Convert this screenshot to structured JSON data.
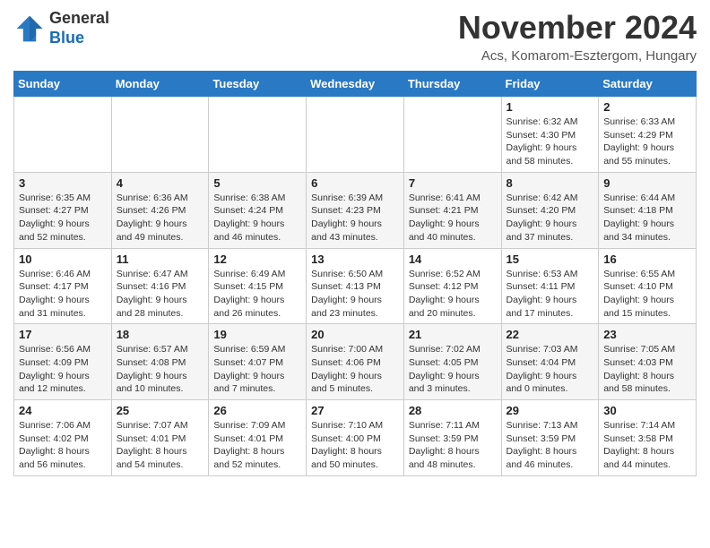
{
  "header": {
    "logo_line1": "General",
    "logo_line2": "Blue",
    "month": "November 2024",
    "location": "Acs, Komarom-Esztergom, Hungary"
  },
  "weekdays": [
    "Sunday",
    "Monday",
    "Tuesday",
    "Wednesday",
    "Thursday",
    "Friday",
    "Saturday"
  ],
  "weeks": [
    [
      {
        "day": "",
        "info": ""
      },
      {
        "day": "",
        "info": ""
      },
      {
        "day": "",
        "info": ""
      },
      {
        "day": "",
        "info": ""
      },
      {
        "day": "",
        "info": ""
      },
      {
        "day": "1",
        "info": "Sunrise: 6:32 AM\nSunset: 4:30 PM\nDaylight: 9 hours and 58 minutes."
      },
      {
        "day": "2",
        "info": "Sunrise: 6:33 AM\nSunset: 4:29 PM\nDaylight: 9 hours and 55 minutes."
      }
    ],
    [
      {
        "day": "3",
        "info": "Sunrise: 6:35 AM\nSunset: 4:27 PM\nDaylight: 9 hours and 52 minutes."
      },
      {
        "day": "4",
        "info": "Sunrise: 6:36 AM\nSunset: 4:26 PM\nDaylight: 9 hours and 49 minutes."
      },
      {
        "day": "5",
        "info": "Sunrise: 6:38 AM\nSunset: 4:24 PM\nDaylight: 9 hours and 46 minutes."
      },
      {
        "day": "6",
        "info": "Sunrise: 6:39 AM\nSunset: 4:23 PM\nDaylight: 9 hours and 43 minutes."
      },
      {
        "day": "7",
        "info": "Sunrise: 6:41 AM\nSunset: 4:21 PM\nDaylight: 9 hours and 40 minutes."
      },
      {
        "day": "8",
        "info": "Sunrise: 6:42 AM\nSunset: 4:20 PM\nDaylight: 9 hours and 37 minutes."
      },
      {
        "day": "9",
        "info": "Sunrise: 6:44 AM\nSunset: 4:18 PM\nDaylight: 9 hours and 34 minutes."
      }
    ],
    [
      {
        "day": "10",
        "info": "Sunrise: 6:46 AM\nSunset: 4:17 PM\nDaylight: 9 hours and 31 minutes."
      },
      {
        "day": "11",
        "info": "Sunrise: 6:47 AM\nSunset: 4:16 PM\nDaylight: 9 hours and 28 minutes."
      },
      {
        "day": "12",
        "info": "Sunrise: 6:49 AM\nSunset: 4:15 PM\nDaylight: 9 hours and 26 minutes."
      },
      {
        "day": "13",
        "info": "Sunrise: 6:50 AM\nSunset: 4:13 PM\nDaylight: 9 hours and 23 minutes."
      },
      {
        "day": "14",
        "info": "Sunrise: 6:52 AM\nSunset: 4:12 PM\nDaylight: 9 hours and 20 minutes."
      },
      {
        "day": "15",
        "info": "Sunrise: 6:53 AM\nSunset: 4:11 PM\nDaylight: 9 hours and 17 minutes."
      },
      {
        "day": "16",
        "info": "Sunrise: 6:55 AM\nSunset: 4:10 PM\nDaylight: 9 hours and 15 minutes."
      }
    ],
    [
      {
        "day": "17",
        "info": "Sunrise: 6:56 AM\nSunset: 4:09 PM\nDaylight: 9 hours and 12 minutes."
      },
      {
        "day": "18",
        "info": "Sunrise: 6:57 AM\nSunset: 4:08 PM\nDaylight: 9 hours and 10 minutes."
      },
      {
        "day": "19",
        "info": "Sunrise: 6:59 AM\nSunset: 4:07 PM\nDaylight: 9 hours and 7 minutes."
      },
      {
        "day": "20",
        "info": "Sunrise: 7:00 AM\nSunset: 4:06 PM\nDaylight: 9 hours and 5 minutes."
      },
      {
        "day": "21",
        "info": "Sunrise: 7:02 AM\nSunset: 4:05 PM\nDaylight: 9 hours and 3 minutes."
      },
      {
        "day": "22",
        "info": "Sunrise: 7:03 AM\nSunset: 4:04 PM\nDaylight: 9 hours and 0 minutes."
      },
      {
        "day": "23",
        "info": "Sunrise: 7:05 AM\nSunset: 4:03 PM\nDaylight: 8 hours and 58 minutes."
      }
    ],
    [
      {
        "day": "24",
        "info": "Sunrise: 7:06 AM\nSunset: 4:02 PM\nDaylight: 8 hours and 56 minutes."
      },
      {
        "day": "25",
        "info": "Sunrise: 7:07 AM\nSunset: 4:01 PM\nDaylight: 8 hours and 54 minutes."
      },
      {
        "day": "26",
        "info": "Sunrise: 7:09 AM\nSunset: 4:01 PM\nDaylight: 8 hours and 52 minutes."
      },
      {
        "day": "27",
        "info": "Sunrise: 7:10 AM\nSunset: 4:00 PM\nDaylight: 8 hours and 50 minutes."
      },
      {
        "day": "28",
        "info": "Sunrise: 7:11 AM\nSunset: 3:59 PM\nDaylight: 8 hours and 48 minutes."
      },
      {
        "day": "29",
        "info": "Sunrise: 7:13 AM\nSunset: 3:59 PM\nDaylight: 8 hours and 46 minutes."
      },
      {
        "day": "30",
        "info": "Sunrise: 7:14 AM\nSunset: 3:58 PM\nDaylight: 8 hours and 44 minutes."
      }
    ]
  ]
}
